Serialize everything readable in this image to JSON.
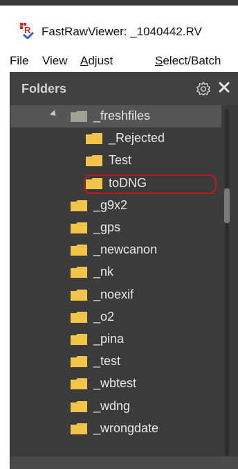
{
  "window": {
    "title": "FastRawViewer: _1040442.RV",
    "logo_icon": "fastrawviewer-logo-icon"
  },
  "menu": {
    "items": [
      {
        "label": "File",
        "underline": ""
      },
      {
        "label": "View",
        "underline": ""
      },
      {
        "label": "Adjust",
        "underline": "A"
      },
      {
        "label": "Select/Batch",
        "underline": "S"
      }
    ]
  },
  "folders_panel": {
    "title": "Folders",
    "settings_icon": "gear-icon",
    "close_icon": "close-icon",
    "highlight_color": "#c01818",
    "tree": [
      {
        "label": "_freshfiles",
        "level": 0,
        "expanded": true,
        "selected": true,
        "folder_color": "#9fa293"
      },
      {
        "label": "_Rejected",
        "level": 1,
        "folder_color": "#f2c44a"
      },
      {
        "label": "Test",
        "level": 1,
        "folder_color": "#f2c44a"
      },
      {
        "label": "toDNG",
        "level": 1,
        "folder_color": "#f2c44a",
        "highlighted": true
      },
      {
        "label": "_g9x2",
        "level": 0,
        "folder_color": "#f2c44a"
      },
      {
        "label": "_gps",
        "level": 0,
        "folder_color": "#f2c44a"
      },
      {
        "label": "_newcanon",
        "level": 0,
        "folder_color": "#f2c44a"
      },
      {
        "label": "_nk",
        "level": 0,
        "folder_color": "#f2c44a"
      },
      {
        "label": "_noexif",
        "level": 0,
        "folder_color": "#f2c44a"
      },
      {
        "label": "_o2",
        "level": 0,
        "folder_color": "#f2c44a"
      },
      {
        "label": "_pina",
        "level": 0,
        "folder_color": "#f2c44a"
      },
      {
        "label": "_test",
        "level": 0,
        "folder_color": "#f2c44a"
      },
      {
        "label": "_wbtest",
        "level": 0,
        "folder_color": "#f2c44a"
      },
      {
        "label": "_wdng",
        "level": 0,
        "folder_color": "#f2c44a"
      },
      {
        "label": "_wrongdate",
        "level": 0,
        "folder_color": "#f2c44a"
      }
    ]
  }
}
